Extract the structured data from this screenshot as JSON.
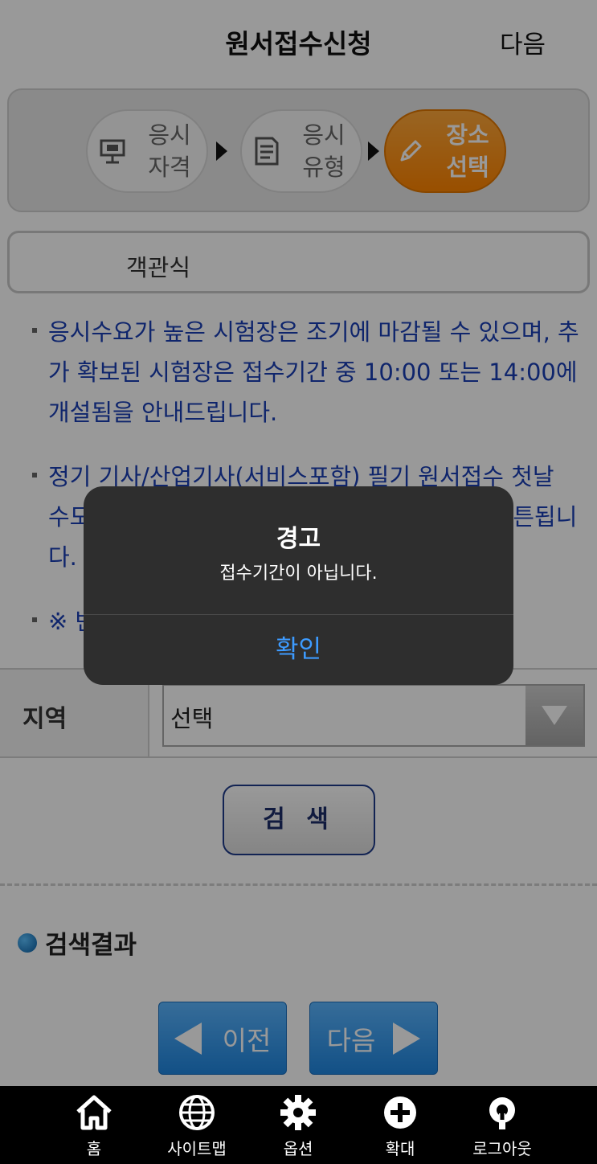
{
  "header": {
    "title": "원서접수신청",
    "next_label": "다음"
  },
  "steps": [
    {
      "line1": "응시",
      "line2": "자격",
      "icon": "presentation-icon",
      "active": false
    },
    {
      "line1": "응시",
      "line2": "유형",
      "icon": "document-icon",
      "active": false
    },
    {
      "line1": "장소",
      "line2": "선택",
      "icon": "pencil-icon",
      "active": true
    }
  ],
  "exam_type": "객관식",
  "notices": [
    "응시수요가 높은 시험장은 조기에 마감될 수 있으며, 추가 확보된 시험장은 접수기간 중 10:00 또는 14:00에 개설됨을 안내드립니다.",
    "정기 기사/산업기사(서비스포함) 필기 원서접수 첫날 수도권 지역 접수 시작 시간은 별도로 안내되며, 회차별로 상이할 수 있으니 안내를 확인 바랍니다. 접수 순서에 따라 대기가 발생할 수 있습니다.",
    "※ 반"
  ],
  "notice_visible": {
    "n2_line2_left": "수도",
    "n2_line2_right": "튼됩니",
    "n2_line3": "다.",
    "n3": "※ 반"
  },
  "region": {
    "label": "지역",
    "selected": "선택"
  },
  "search_button": "검 색",
  "results_title": "검색결과",
  "nav": {
    "prev": "이전",
    "next": "다음"
  },
  "tabbar": [
    {
      "label": "홈",
      "icon": "home-icon"
    },
    {
      "label": "사이트맵",
      "icon": "globe-icon"
    },
    {
      "label": "옵션",
      "icon": "gear-icon"
    },
    {
      "label": "확대",
      "icon": "plus-circle-icon"
    },
    {
      "label": "로그아웃",
      "icon": "logout-icon"
    }
  ],
  "alert": {
    "title": "경고",
    "message": "접수기간이 아닙니다.",
    "ok": "확인"
  },
  "colors": {
    "accent_orange": "#ff8c1a",
    "link_blue": "#1a3fb5",
    "button_blue": "#2a8ce6",
    "alert_ok": "#3d9bff"
  }
}
